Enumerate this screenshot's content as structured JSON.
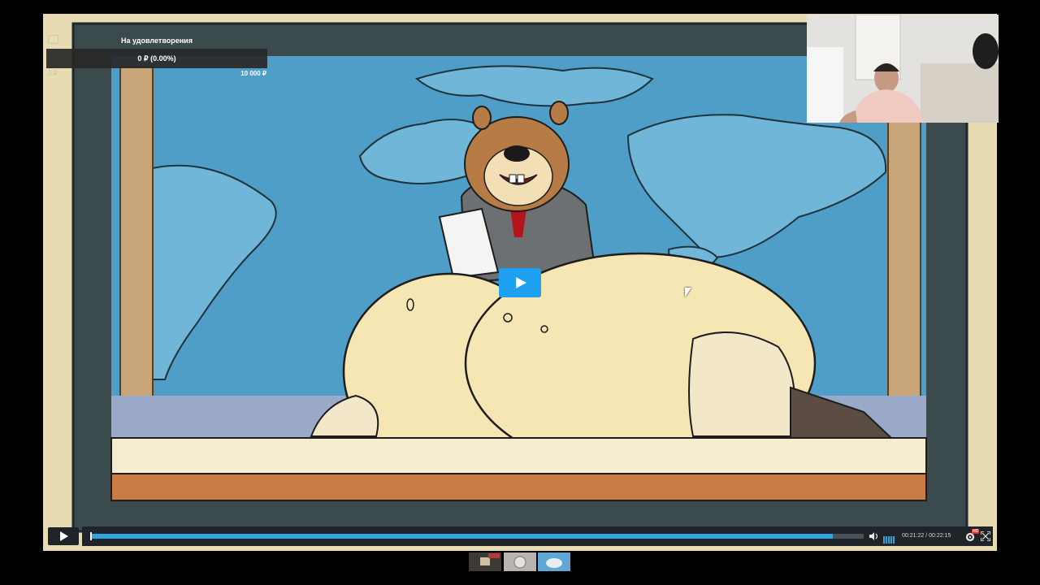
{
  "goal": {
    "title": "На удовлетворения",
    "value_label": "0 ₽ (0.00%)",
    "progress": 0.0,
    "min_label": "0 ₽",
    "max_label": "10 000 ₽"
  },
  "player": {
    "current_time": "00:21:22",
    "duration": "00:22:15",
    "time_separator": " / ",
    "progress": 0.96,
    "volume": 1.0,
    "quality_badge": "HD",
    "accent_color": "#2fa4df"
  },
  "icons": {
    "play": "play-icon",
    "volume": "volume-icon",
    "settings": "gear-icon",
    "fullscreen": "fullscreen-icon"
  }
}
